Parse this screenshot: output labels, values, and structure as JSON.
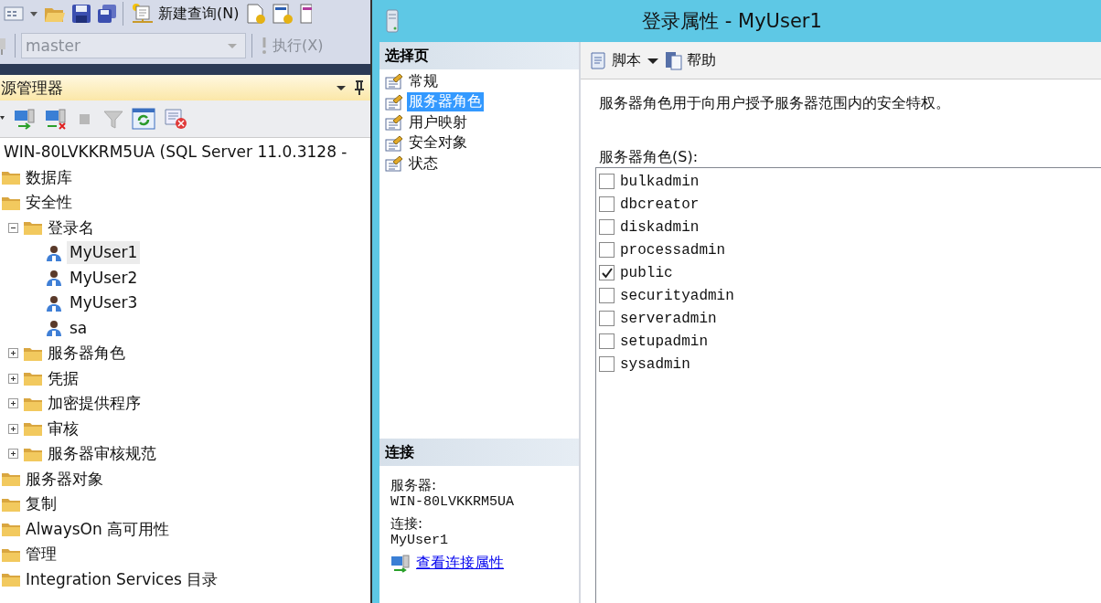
{
  "main_toolbar": {
    "new_query": "新建查询(N)",
    "database": "master",
    "execute": "执行(X)"
  },
  "object_explorer": {
    "title": "源管理器",
    "tree": [
      {
        "label": "WIN-80LVKKRM5UA (SQL Server 11.0.3128 -",
        "selected": false,
        "children": [
          {
            "label": "数据库",
            "kind": "folder",
            "selected": false
          },
          {
            "label": "安全性",
            "kind": "folder",
            "selected": false,
            "children": [
              {
                "label": "登录名",
                "kind": "folder",
                "selected": false,
                "expanded": true,
                "children": [
                  {
                    "label": "MyUser1",
                    "kind": "login",
                    "selected": true
                  },
                  {
                    "label": "MyUser2",
                    "kind": "login",
                    "selected": false
                  },
                  {
                    "label": "MyUser3",
                    "kind": "login",
                    "selected": false
                  },
                  {
                    "label": "sa",
                    "kind": "login",
                    "selected": false
                  }
                ]
              },
              {
                "label": "服务器角色",
                "kind": "folder",
                "selected": false,
                "expanded": false
              },
              {
                "label": "凭据",
                "kind": "folder",
                "selected": false,
                "expanded": false
              },
              {
                "label": "加密提供程序",
                "kind": "folder",
                "selected": false,
                "expanded": false
              },
              {
                "label": "审核",
                "kind": "folder",
                "selected": false,
                "expanded": false
              },
              {
                "label": "服务器审核规范",
                "kind": "folder",
                "selected": false,
                "expanded": false
              }
            ]
          },
          {
            "label": "服务器对象",
            "kind": "folder",
            "selected": false
          },
          {
            "label": "复制",
            "kind": "folder",
            "selected": false
          },
          {
            "label": "AlwaysOn 高可用性",
            "kind": "folder",
            "selected": false
          },
          {
            "label": "管理",
            "kind": "folder",
            "selected": false
          },
          {
            "label": "Integration Services 目录",
            "kind": "folder",
            "selected": false
          }
        ]
      }
    ]
  },
  "dialog": {
    "title": "登录属性 - MyUser1",
    "select_page": {
      "title": "选择页",
      "items": [
        {
          "label": "常规",
          "selected": false
        },
        {
          "label": "服务器角色",
          "selected": true
        },
        {
          "label": "用户映射",
          "selected": false
        },
        {
          "label": "安全对象",
          "selected": false
        },
        {
          "label": "状态",
          "selected": false
        }
      ]
    },
    "connection": {
      "title": "连接",
      "server_label": "服务器:",
      "server": "WIN-80LVKKRM5UA",
      "connection_label": "连接:",
      "connection": "MyUser1",
      "link": "查看连接属性"
    },
    "toolbar": {
      "script": "脚本",
      "help": "帮助"
    },
    "description": "服务器角色用于向用户授予服务器范围内的安全特权。",
    "roles_label": "服务器角色(S):",
    "roles": [
      {
        "name": "bulkadmin",
        "checked": false
      },
      {
        "name": "dbcreator",
        "checked": false
      },
      {
        "name": "diskadmin",
        "checked": false
      },
      {
        "name": "processadmin",
        "checked": false
      },
      {
        "name": "public",
        "checked": true
      },
      {
        "name": "securityadmin",
        "checked": false
      },
      {
        "name": "serveradmin",
        "checked": false
      },
      {
        "name": "setupadmin",
        "checked": false
      },
      {
        "name": "sysadmin",
        "checked": false
      }
    ]
  }
}
